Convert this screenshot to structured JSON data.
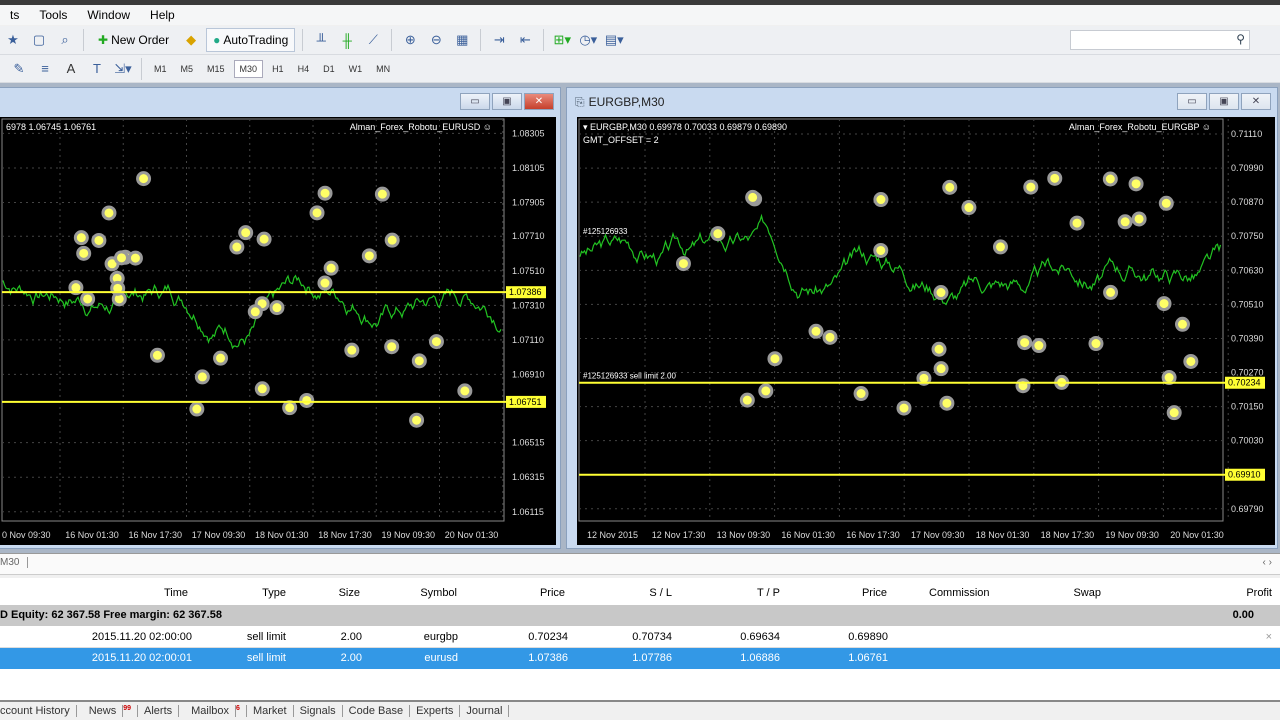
{
  "menu": [
    "ts",
    "Tools",
    "Window",
    "Help"
  ],
  "toolbar": {
    "new_order": "New Order",
    "autotrading": "AutoTrading",
    "timeframes": [
      "M1",
      "M5",
      "M15",
      "M30",
      "H1",
      "H4",
      "D1",
      "W1",
      "MN"
    ],
    "active_timeframe": "M30"
  },
  "charts": [
    {
      "title": "",
      "header": "6978 1.06745 1.06761",
      "expert": "Alman_Forex_Robotu_EURUSD",
      "ylim": [
        1.0605,
        1.084
      ],
      "price_labels": [
        "1.08305",
        "1.08105",
        "1.07905",
        "1.07710",
        "1.07510",
        "1.07310",
        "1.07110",
        "1.06910",
        "1.06515",
        "1.06315",
        "1.06115"
      ],
      "price_values": [
        1.08305,
        1.08105,
        1.07905,
        1.0771,
        1.0751,
        1.0731,
        1.0711,
        1.0691,
        1.06515,
        1.06315,
        1.06115
      ],
      "levels": [
        {
          "label": "1.07386",
          "value": 1.07386
        },
        {
          "label": "1.06751",
          "value": 1.06751
        }
      ],
      "time_labels": [
        "0 Nov 09:30",
        "16 Nov 01:30",
        "16 Nov 17:30",
        "17 Nov 09:30",
        "18 Nov 01:30",
        "18 Nov 17:30",
        "19 Nov 09:30",
        "20 Nov 01:30"
      ],
      "start": 1.0745,
      "seed": 7
    },
    {
      "title": "EURGBP,M30",
      "header": "EURGBP,M30  0.69978 0.70033 0.69879 0.69890",
      "gmt": "GMT_OFFSET = 2",
      "expert": "Alman_Forex_Robotu_EURGBP",
      "ylim": [
        0.6974,
        0.7117
      ],
      "order_labels": [
        "#125126933",
        "#125126933 sell limit 2.00"
      ],
      "price_labels": [
        "0.71110",
        "0.70990",
        "0.70870",
        "0.70750",
        "0.70630",
        "0.70510",
        "0.70390",
        "0.70270",
        "0.70150",
        "0.70030",
        "0.69790"
      ],
      "price_values": [
        0.7111,
        0.7099,
        0.7087,
        0.7075,
        0.7063,
        0.7051,
        0.7039,
        0.7027,
        0.7015,
        0.7003,
        0.6979
      ],
      "levels": [
        {
          "label": "0.70234",
          "value": 0.70234
        },
        {
          "label": "0.69910",
          "value": 0.6991
        }
      ],
      "time_labels": [
        "12 Nov 2015",
        "12 Nov 17:30",
        "13 Nov 09:30",
        "16 Nov 01:30",
        "16 Nov 17:30",
        "17 Nov 09:30",
        "18 Nov 01:30",
        "18 Nov 17:30",
        "19 Nov 09:30",
        "20 Nov 01:30"
      ],
      "start": 0.7069,
      "seed": 3
    }
  ],
  "strip_label": "M30",
  "terminal": {
    "columns": [
      "Time",
      "Type",
      "Size",
      "Symbol",
      "Price",
      "S / L",
      "T / P",
      "Price",
      "Commission",
      "Swap",
      "Profit"
    ],
    "balance": "D  Equity: 62 367.58  Free margin: 62 367.58",
    "balance_profit": "0.00",
    "rows": [
      [
        "2015.11.20 02:00:00",
        "sell limit",
        "2.00",
        "eurgbp",
        "0.70234",
        "0.70734",
        "0.69634",
        "0.69890"
      ],
      [
        "2015.11.20 02:00:01",
        "sell limit",
        "2.00",
        "eurusd",
        "1.07386",
        "1.07786",
        "1.06886",
        "1.06761"
      ]
    ]
  },
  "bottom_tabs": [
    "ccount History",
    "News",
    "Alerts",
    "Mailbox",
    "Market",
    "Signals",
    "Code Base",
    "Experts",
    "Journal"
  ],
  "news_badge": "99",
  "mailbox_badge": "6",
  "colors": {
    "line": "#22c322",
    "level": "#ffff33",
    "selected": "#3398e6"
  }
}
